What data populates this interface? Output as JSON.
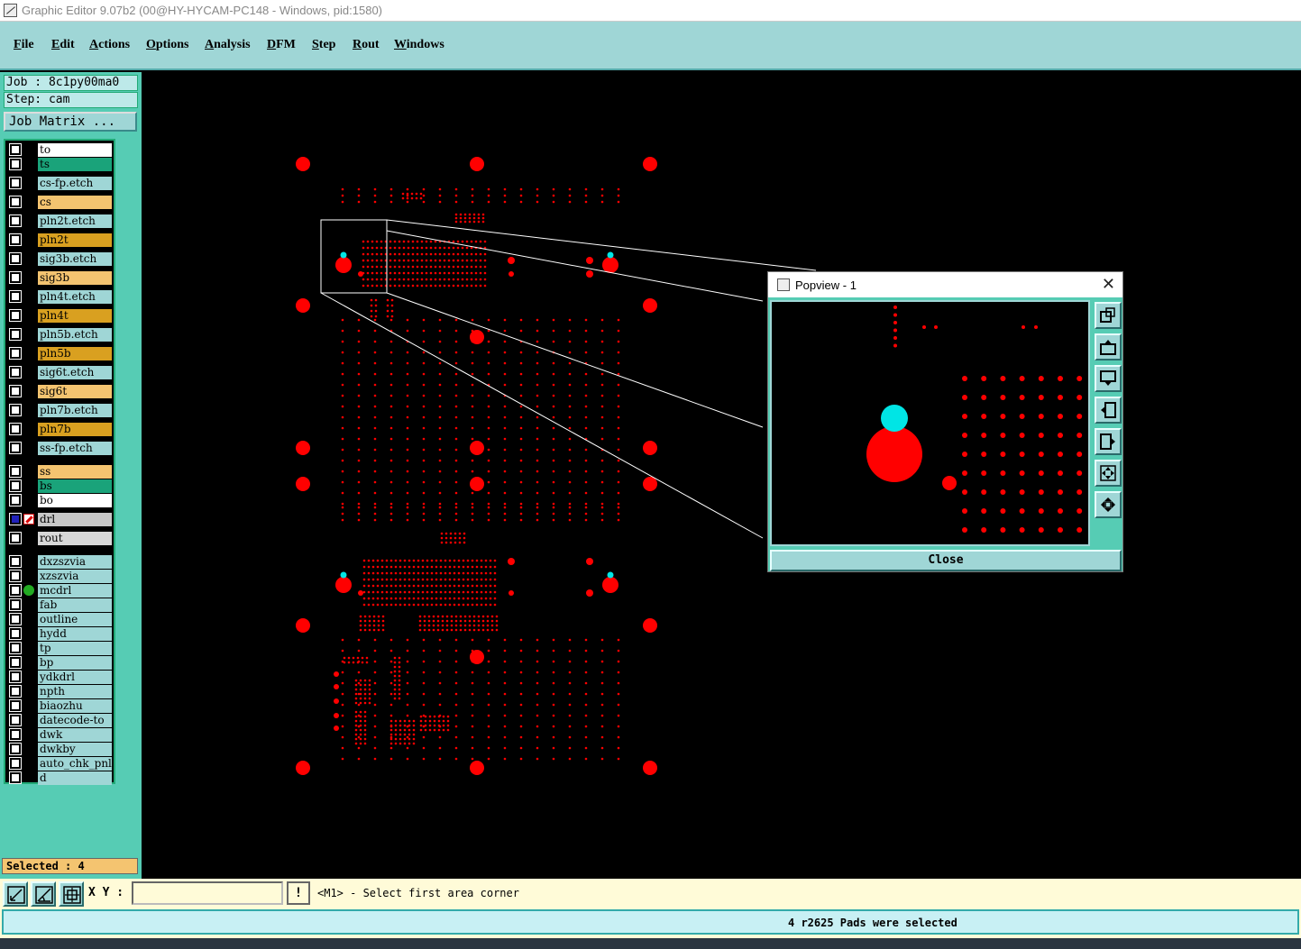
{
  "window": {
    "title": "Graphic Editor 9.07b2 (00@HY-HYCAM-PC148 - Windows, pid:1580)"
  },
  "menu": [
    "File",
    "Edit",
    "Actions",
    "Options",
    "Analysis",
    "DFM",
    "Step",
    "Rout",
    "Windows"
  ],
  "job": {
    "job_label": "Job : 8c1py00ma0",
    "step_label": "Step: cam",
    "matrix_button": "Job Matrix ..."
  },
  "layers": [
    {
      "name": "to",
      "color": "#ffffff"
    },
    {
      "name": "ts",
      "color": "#1aa37a"
    },
    {
      "name": "cs-fp.etch",
      "color": "#9fd6d6"
    },
    {
      "name": "cs",
      "color": "#f4c470"
    },
    {
      "name": "pln2t.etch",
      "color": "#9fd6d6"
    },
    {
      "name": "pln2t",
      "color": "#d9a020"
    },
    {
      "name": "sig3b.etch",
      "color": "#9fd6d6"
    },
    {
      "name": "sig3b",
      "color": "#f4c470"
    },
    {
      "name": "pln4t.etch",
      "color": "#9fd6d6"
    },
    {
      "name": "pln4t",
      "color": "#d9a020"
    },
    {
      "name": "pln5b.etch",
      "color": "#9fd6d6"
    },
    {
      "name": "pln5b",
      "color": "#d9a020"
    },
    {
      "name": "sig6t.etch",
      "color": "#9fd6d6"
    },
    {
      "name": "sig6t",
      "color": "#f4c470"
    },
    {
      "name": "pln7b.etch",
      "color": "#9fd6d6"
    },
    {
      "name": "pln7b",
      "color": "#d9a020"
    },
    {
      "name": "ss-fp.etch",
      "color": "#9fd6d6"
    },
    {
      "name": "ss",
      "color": "#f4c470"
    },
    {
      "name": "bs",
      "color": "#1aa37a"
    },
    {
      "name": "bo",
      "color": "#ffffff"
    },
    {
      "name": "drl",
      "color": "#b8b8b8",
      "selected": true,
      "indicator": "drill-icon"
    },
    {
      "name": "rout",
      "color": "#d8d8d8"
    },
    {
      "name": "dxzszvia",
      "color": "#9fd6d6"
    },
    {
      "name": "xzszvia",
      "color": "#9fd6d6"
    },
    {
      "name": "mcdrl",
      "color": "#9fd6d6",
      "indicator": "green-dot-icon"
    },
    {
      "name": "fab",
      "color": "#9fd6d6"
    },
    {
      "name": "outline",
      "color": "#9fd6d6"
    },
    {
      "name": "hydd",
      "color": "#9fd6d6"
    },
    {
      "name": "tp",
      "color": "#9fd6d6"
    },
    {
      "name": "bp",
      "color": "#9fd6d6"
    },
    {
      "name": "ydkdrl",
      "color": "#9fd6d6"
    },
    {
      "name": "npth",
      "color": "#9fd6d6"
    },
    {
      "name": "biaozhu",
      "color": "#9fd6d6"
    },
    {
      "name": "datecode-to",
      "color": "#9fd6d6"
    },
    {
      "name": "dwk",
      "color": "#9fd6d6"
    },
    {
      "name": "dwkby",
      "color": "#9fd6d6"
    },
    {
      "name": "auto_chk_pnl",
      "color": "#9fd6d6"
    },
    {
      "name": "d",
      "color": "#9fd6d6"
    }
  ],
  "selected_count_label": "Selected : 4",
  "popview": {
    "title": "Popview - 1",
    "close_label": "Close",
    "tools": [
      "zoom-home-icon",
      "pan-up-icon",
      "pan-down-icon",
      "pan-left-icon",
      "pan-right-icon",
      "zoom-out-icon",
      "zoom-in-icon"
    ]
  },
  "bottom": {
    "xy_label": "X Y :",
    "xy_value": "",
    "bang_label": "!",
    "prompt": "<M1> - Select first area corner",
    "status": "4 r2625 Pads were selected"
  },
  "colors": {
    "pad": "#ff0000",
    "selected_pad": "#00e5e5",
    "panel": "#56ccb4",
    "menubar": "#9fd6d6"
  }
}
